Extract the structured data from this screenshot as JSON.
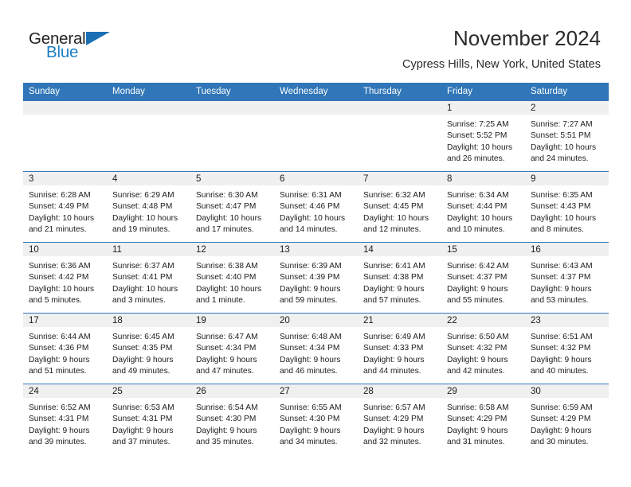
{
  "brand": {
    "name_top": "General",
    "name_bottom": "Blue",
    "triangle_icon": "triangle-icon",
    "color_dark": "#231f20",
    "color_blue": "#1b7fc4"
  },
  "header": {
    "title": "November 2024",
    "subtitle": "Cypress Hills, New York, United States"
  },
  "theme": {
    "header_blue": "#3076b8",
    "daynum_band": "#f0f0f0",
    "text": "#1c1c1c"
  },
  "calendar": {
    "weekday_headers": [
      "Sunday",
      "Monday",
      "Tuesday",
      "Wednesday",
      "Thursday",
      "Friday",
      "Saturday"
    ],
    "weeks": [
      [
        {
          "day": "",
          "lines": []
        },
        {
          "day": "",
          "lines": []
        },
        {
          "day": "",
          "lines": []
        },
        {
          "day": "",
          "lines": []
        },
        {
          "day": "",
          "lines": []
        },
        {
          "day": "1",
          "lines": [
            "Sunrise: 7:25 AM",
            "Sunset: 5:52 PM",
            "Daylight: 10 hours",
            "and 26 minutes."
          ]
        },
        {
          "day": "2",
          "lines": [
            "Sunrise: 7:27 AM",
            "Sunset: 5:51 PM",
            "Daylight: 10 hours",
            "and 24 minutes."
          ]
        }
      ],
      [
        {
          "day": "3",
          "lines": [
            "Sunrise: 6:28 AM",
            "Sunset: 4:49 PM",
            "Daylight: 10 hours",
            "and 21 minutes."
          ]
        },
        {
          "day": "4",
          "lines": [
            "Sunrise: 6:29 AM",
            "Sunset: 4:48 PM",
            "Daylight: 10 hours",
            "and 19 minutes."
          ]
        },
        {
          "day": "5",
          "lines": [
            "Sunrise: 6:30 AM",
            "Sunset: 4:47 PM",
            "Daylight: 10 hours",
            "and 17 minutes."
          ]
        },
        {
          "day": "6",
          "lines": [
            "Sunrise: 6:31 AM",
            "Sunset: 4:46 PM",
            "Daylight: 10 hours",
            "and 14 minutes."
          ]
        },
        {
          "day": "7",
          "lines": [
            "Sunrise: 6:32 AM",
            "Sunset: 4:45 PM",
            "Daylight: 10 hours",
            "and 12 minutes."
          ]
        },
        {
          "day": "8",
          "lines": [
            "Sunrise: 6:34 AM",
            "Sunset: 4:44 PM",
            "Daylight: 10 hours",
            "and 10 minutes."
          ]
        },
        {
          "day": "9",
          "lines": [
            "Sunrise: 6:35 AM",
            "Sunset: 4:43 PM",
            "Daylight: 10 hours",
            "and 8 minutes."
          ]
        }
      ],
      [
        {
          "day": "10",
          "lines": [
            "Sunrise: 6:36 AM",
            "Sunset: 4:42 PM",
            "Daylight: 10 hours",
            "and 5 minutes."
          ]
        },
        {
          "day": "11",
          "lines": [
            "Sunrise: 6:37 AM",
            "Sunset: 4:41 PM",
            "Daylight: 10 hours",
            "and 3 minutes."
          ]
        },
        {
          "day": "12",
          "lines": [
            "Sunrise: 6:38 AM",
            "Sunset: 4:40 PM",
            "Daylight: 10 hours",
            "and 1 minute."
          ]
        },
        {
          "day": "13",
          "lines": [
            "Sunrise: 6:39 AM",
            "Sunset: 4:39 PM",
            "Daylight: 9 hours",
            "and 59 minutes."
          ]
        },
        {
          "day": "14",
          "lines": [
            "Sunrise: 6:41 AM",
            "Sunset: 4:38 PM",
            "Daylight: 9 hours",
            "and 57 minutes."
          ]
        },
        {
          "day": "15",
          "lines": [
            "Sunrise: 6:42 AM",
            "Sunset: 4:37 PM",
            "Daylight: 9 hours",
            "and 55 minutes."
          ]
        },
        {
          "day": "16",
          "lines": [
            "Sunrise: 6:43 AM",
            "Sunset: 4:37 PM",
            "Daylight: 9 hours",
            "and 53 minutes."
          ]
        }
      ],
      [
        {
          "day": "17",
          "lines": [
            "Sunrise: 6:44 AM",
            "Sunset: 4:36 PM",
            "Daylight: 9 hours",
            "and 51 minutes."
          ]
        },
        {
          "day": "18",
          "lines": [
            "Sunrise: 6:45 AM",
            "Sunset: 4:35 PM",
            "Daylight: 9 hours",
            "and 49 minutes."
          ]
        },
        {
          "day": "19",
          "lines": [
            "Sunrise: 6:47 AM",
            "Sunset: 4:34 PM",
            "Daylight: 9 hours",
            "and 47 minutes."
          ]
        },
        {
          "day": "20",
          "lines": [
            "Sunrise: 6:48 AM",
            "Sunset: 4:34 PM",
            "Daylight: 9 hours",
            "and 46 minutes."
          ]
        },
        {
          "day": "21",
          "lines": [
            "Sunrise: 6:49 AM",
            "Sunset: 4:33 PM",
            "Daylight: 9 hours",
            "and 44 minutes."
          ]
        },
        {
          "day": "22",
          "lines": [
            "Sunrise: 6:50 AM",
            "Sunset: 4:32 PM",
            "Daylight: 9 hours",
            "and 42 minutes."
          ]
        },
        {
          "day": "23",
          "lines": [
            "Sunrise: 6:51 AM",
            "Sunset: 4:32 PM",
            "Daylight: 9 hours",
            "and 40 minutes."
          ]
        }
      ],
      [
        {
          "day": "24",
          "lines": [
            "Sunrise: 6:52 AM",
            "Sunset: 4:31 PM",
            "Daylight: 9 hours",
            "and 39 minutes."
          ]
        },
        {
          "day": "25",
          "lines": [
            "Sunrise: 6:53 AM",
            "Sunset: 4:31 PM",
            "Daylight: 9 hours",
            "and 37 minutes."
          ]
        },
        {
          "day": "26",
          "lines": [
            "Sunrise: 6:54 AM",
            "Sunset: 4:30 PM",
            "Daylight: 9 hours",
            "and 35 minutes."
          ]
        },
        {
          "day": "27",
          "lines": [
            "Sunrise: 6:55 AM",
            "Sunset: 4:30 PM",
            "Daylight: 9 hours",
            "and 34 minutes."
          ]
        },
        {
          "day": "28",
          "lines": [
            "Sunrise: 6:57 AM",
            "Sunset: 4:29 PM",
            "Daylight: 9 hours",
            "and 32 minutes."
          ]
        },
        {
          "day": "29",
          "lines": [
            "Sunrise: 6:58 AM",
            "Sunset: 4:29 PM",
            "Daylight: 9 hours",
            "and 31 minutes."
          ]
        },
        {
          "day": "30",
          "lines": [
            "Sunrise: 6:59 AM",
            "Sunset: 4:29 PM",
            "Daylight: 9 hours",
            "and 30 minutes."
          ]
        }
      ]
    ]
  }
}
